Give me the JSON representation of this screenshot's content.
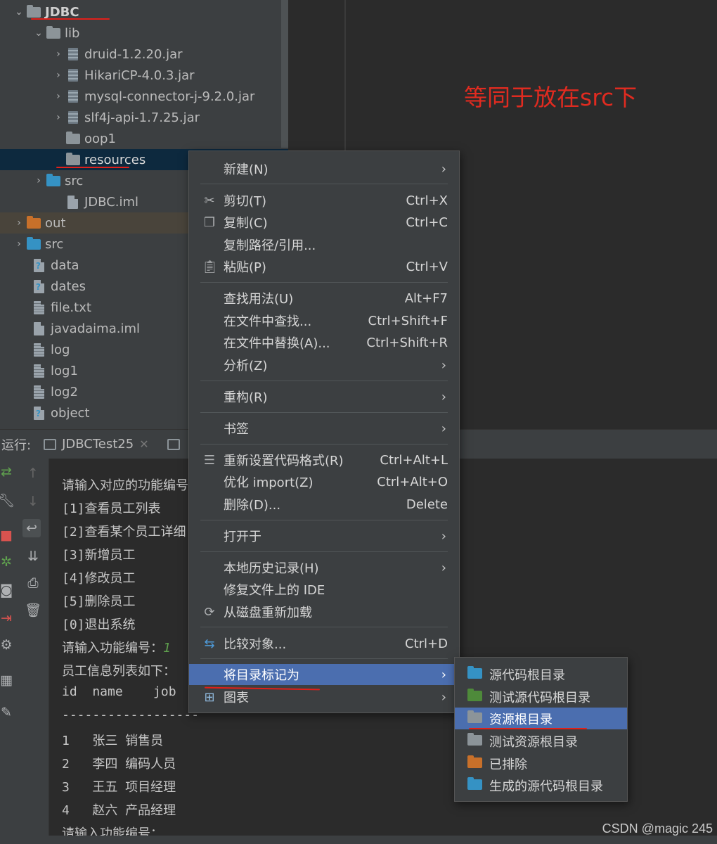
{
  "project_tree": {
    "items": [
      {
        "label": "JDBC",
        "icon": "module-folder-icon",
        "expanded": true
      },
      {
        "label": "lib",
        "icon": "folder-icon",
        "expanded": true
      },
      {
        "label": "druid-1.2.20.jar",
        "icon": "jar-icon"
      },
      {
        "label": "HikariCP-4.0.3.jar",
        "icon": "jar-icon"
      },
      {
        "label": "mysql-connector-j-9.2.0.jar",
        "icon": "jar-icon"
      },
      {
        "label": "slf4j-api-1.7.25.jar",
        "icon": "jar-icon"
      },
      {
        "label": "oop1",
        "icon": "folder-icon"
      },
      {
        "label": "resources",
        "icon": "folder-icon",
        "selected": true
      },
      {
        "label": "src",
        "icon": "source-folder-icon"
      },
      {
        "label": "JDBC.iml",
        "icon": "iml-file-icon"
      },
      {
        "label": "out",
        "icon": "excluded-folder-icon"
      },
      {
        "label": "src",
        "icon": "source-folder-icon"
      },
      {
        "label": "data",
        "icon": "unknown-file-icon"
      },
      {
        "label": "dates",
        "icon": "unknown-file-icon"
      },
      {
        "label": "file.txt",
        "icon": "text-file-icon"
      },
      {
        "label": "javadaima.iml",
        "icon": "iml-file-icon"
      },
      {
        "label": "log",
        "icon": "text-file-icon"
      },
      {
        "label": "log1",
        "icon": "text-file-icon"
      },
      {
        "label": "log2",
        "icon": "text-file-icon"
      },
      {
        "label": "object",
        "icon": "unknown-file-icon"
      }
    ]
  },
  "annotation": {
    "text": "等同于放在src下",
    "color": "#e02b20"
  },
  "run_panel": {
    "label": "运行:",
    "tab_label": "JDBCTest25",
    "console": {
      "lines": [
        "请输入对应的功能编号",
        "[1]查看员工列表",
        "[2]查看某个员工详细",
        "[3]新增员工",
        "[4]修改员工",
        "[5]删除员工",
        "[0]退出系统",
        "请输入功能编号：",
        "员工信息列表如下：",
        "id  name    job",
        "------------------",
        "1   张三 销售员",
        "2   李四 编码人员",
        "3   王五 项目经理",
        "4   赵六 产品经理",
        "请输入功能编号："
      ],
      "input_value": "1"
    }
  },
  "context_menu": {
    "new": {
      "label": "新建(N)"
    },
    "cut": {
      "label": "剪切(T)",
      "shortcut": "Ctrl+X",
      "icon": "scissors-icon"
    },
    "copy": {
      "label": "复制(C)",
      "shortcut": "Ctrl+C",
      "icon": "copy-icon"
    },
    "copy_path": {
      "label": "复制路径/引用..."
    },
    "paste": {
      "label": "粘贴(P)",
      "shortcut": "Ctrl+V",
      "icon": "clipboard-icon"
    },
    "find_usages": {
      "label": "查找用法(U)",
      "shortcut": "Alt+F7"
    },
    "find_in_files": {
      "label": "在文件中查找...",
      "shortcut": "Ctrl+Shift+F"
    },
    "replace_in_files": {
      "label": "在文件中替换(A)...",
      "shortcut": "Ctrl+Shift+R"
    },
    "analyze": {
      "label": "分析(Z)"
    },
    "refactor": {
      "label": "重构(R)"
    },
    "bookmarks": {
      "label": "书签"
    },
    "reformat": {
      "label": "重新设置代码格式(R)",
      "shortcut": "Ctrl+Alt+L",
      "icon": "reformat-icon"
    },
    "optimize_imports": {
      "label": "优化 import(Z)",
      "shortcut": "Ctrl+Alt+O"
    },
    "delete": {
      "label": "删除(D)...",
      "shortcut": "Delete"
    },
    "open_in": {
      "label": "打开于"
    },
    "local_history": {
      "label": "本地历史记录(H)"
    },
    "repair_ide": {
      "label": "修复文件上的 IDE"
    },
    "reload_from_disk": {
      "label": "从磁盘重新加载",
      "icon": "reload-icon"
    },
    "compare_with": {
      "label": "比较对象...",
      "shortcut": "Ctrl+D",
      "icon": "compare-icon"
    },
    "mark_directory_as": {
      "label": "将目录标记为",
      "highlighted": true
    },
    "diagrams": {
      "label": "图表",
      "icon": "diagram-icon"
    }
  },
  "submenu": {
    "items": [
      {
        "label": "源代码根目录",
        "icon": "source-root-icon",
        "color": "#3592c4"
      },
      {
        "label": "测试源代码根目录",
        "icon": "test-source-root-icon",
        "color": "#4e8a3a"
      },
      {
        "label": "资源根目录",
        "icon": "resources-root-icon",
        "color": "#8c9499",
        "highlighted": true
      },
      {
        "label": "测试资源根目录",
        "icon": "test-resources-root-icon",
        "color": "#8c9499"
      },
      {
        "label": "已排除",
        "icon": "excluded-icon",
        "color": "#c8702a"
      },
      {
        "label": "生成的源代码根目录",
        "icon": "generated-source-root-icon",
        "color": "#3592c4"
      }
    ]
  },
  "watermark": "CSDN @magic 245",
  "colors": {
    "selection": "#4b6eaf",
    "panel_bg": "#3c3f41",
    "editor_bg": "#2b2b2b",
    "annotation_red": "#e02b20"
  }
}
